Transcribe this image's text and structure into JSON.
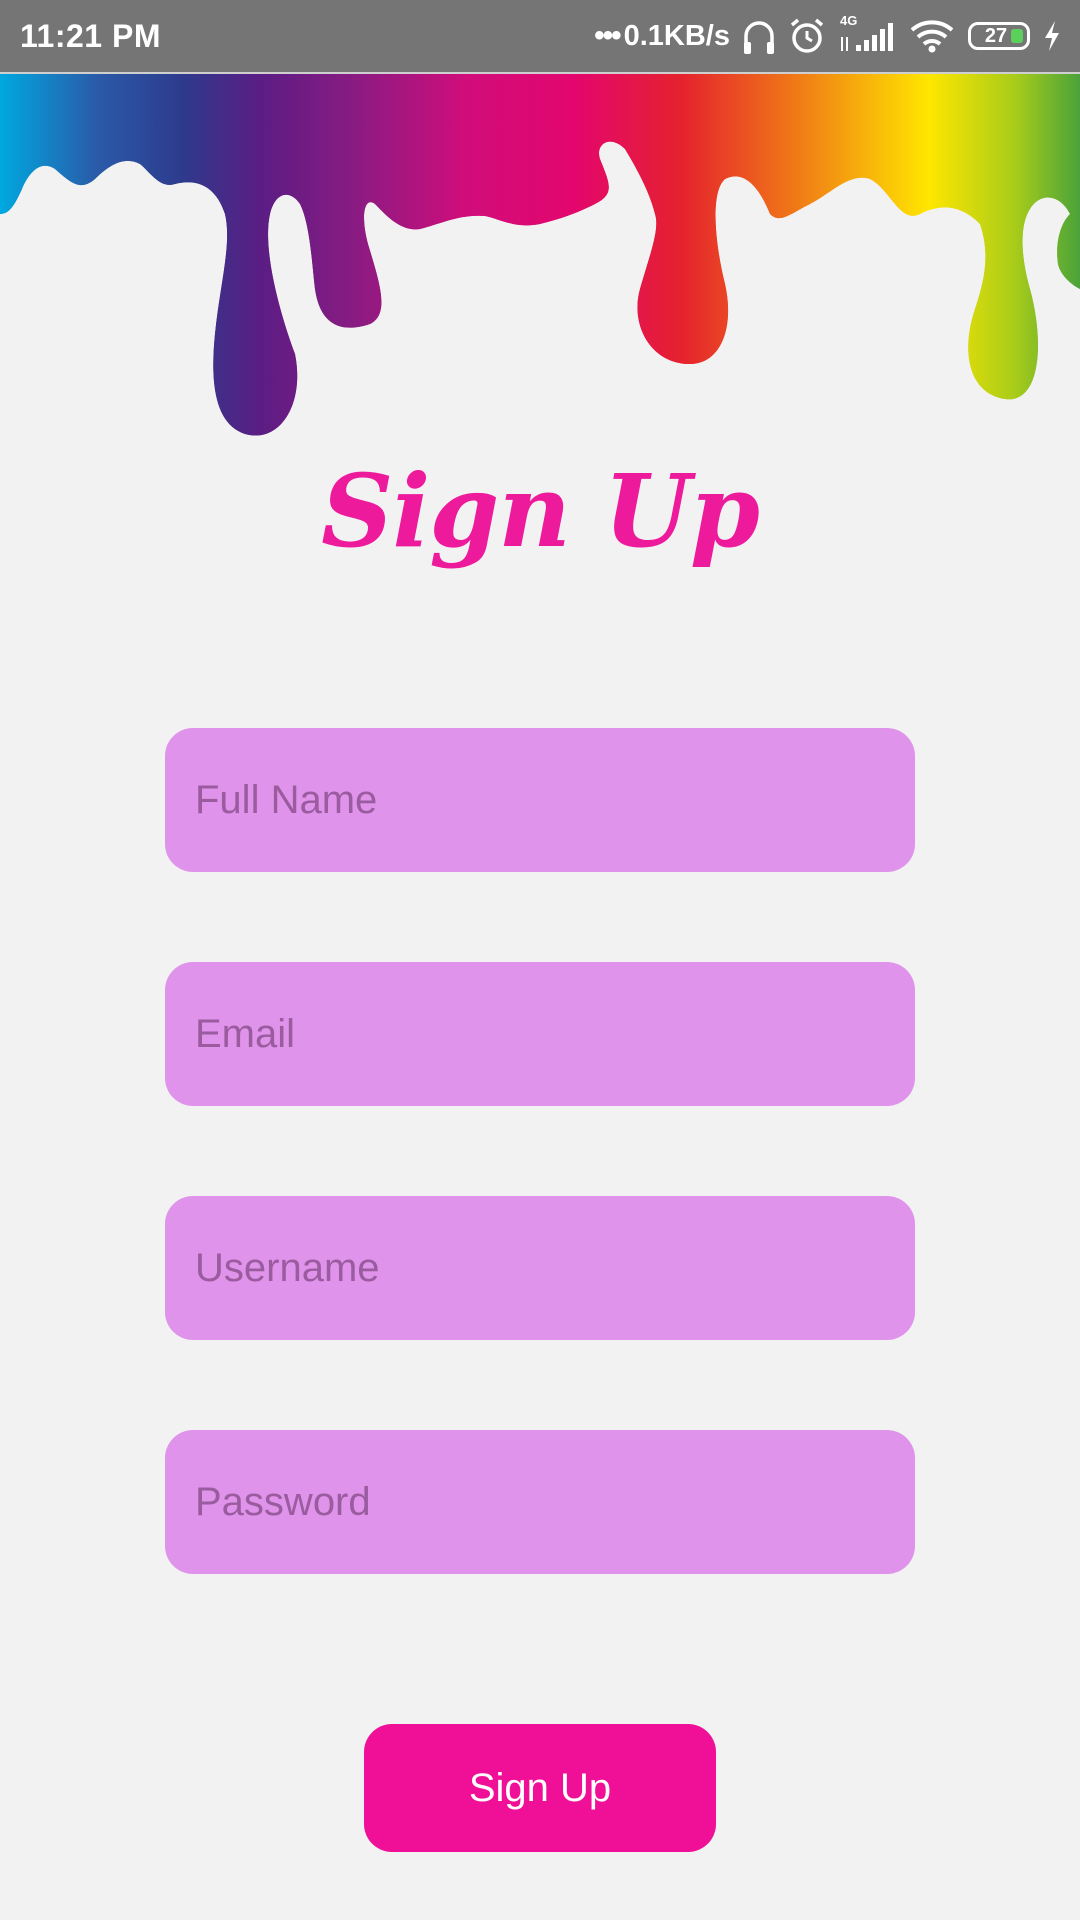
{
  "status_bar": {
    "time": "11:21 PM",
    "dots": "•••",
    "net_speed": "0.1KB/s",
    "network_type": "4G",
    "battery_level": "27",
    "icons": [
      "headphones-icon",
      "alarm-icon",
      "signal-icon",
      "wifi-icon",
      "battery-icon",
      "charging-icon"
    ]
  },
  "header": {
    "title": "Sign Up",
    "paint_colors": [
      "#00a8e0",
      "#2e3a8c",
      "#5a1d84",
      "#b4137f",
      "#e3066e",
      "#e5212e",
      "#f07c16",
      "#ffe600",
      "#a8cc1a",
      "#5aa72a"
    ]
  },
  "form": {
    "full_name_placeholder": "Full Name",
    "email_placeholder": "Email",
    "username_placeholder": "Username",
    "password_placeholder": "Password",
    "submit_label": "Sign Up"
  },
  "colors": {
    "background": "#f2f2f2",
    "title": "#ee1a9c",
    "field_background": "#df93ea",
    "button_background": "#f00f97"
  }
}
